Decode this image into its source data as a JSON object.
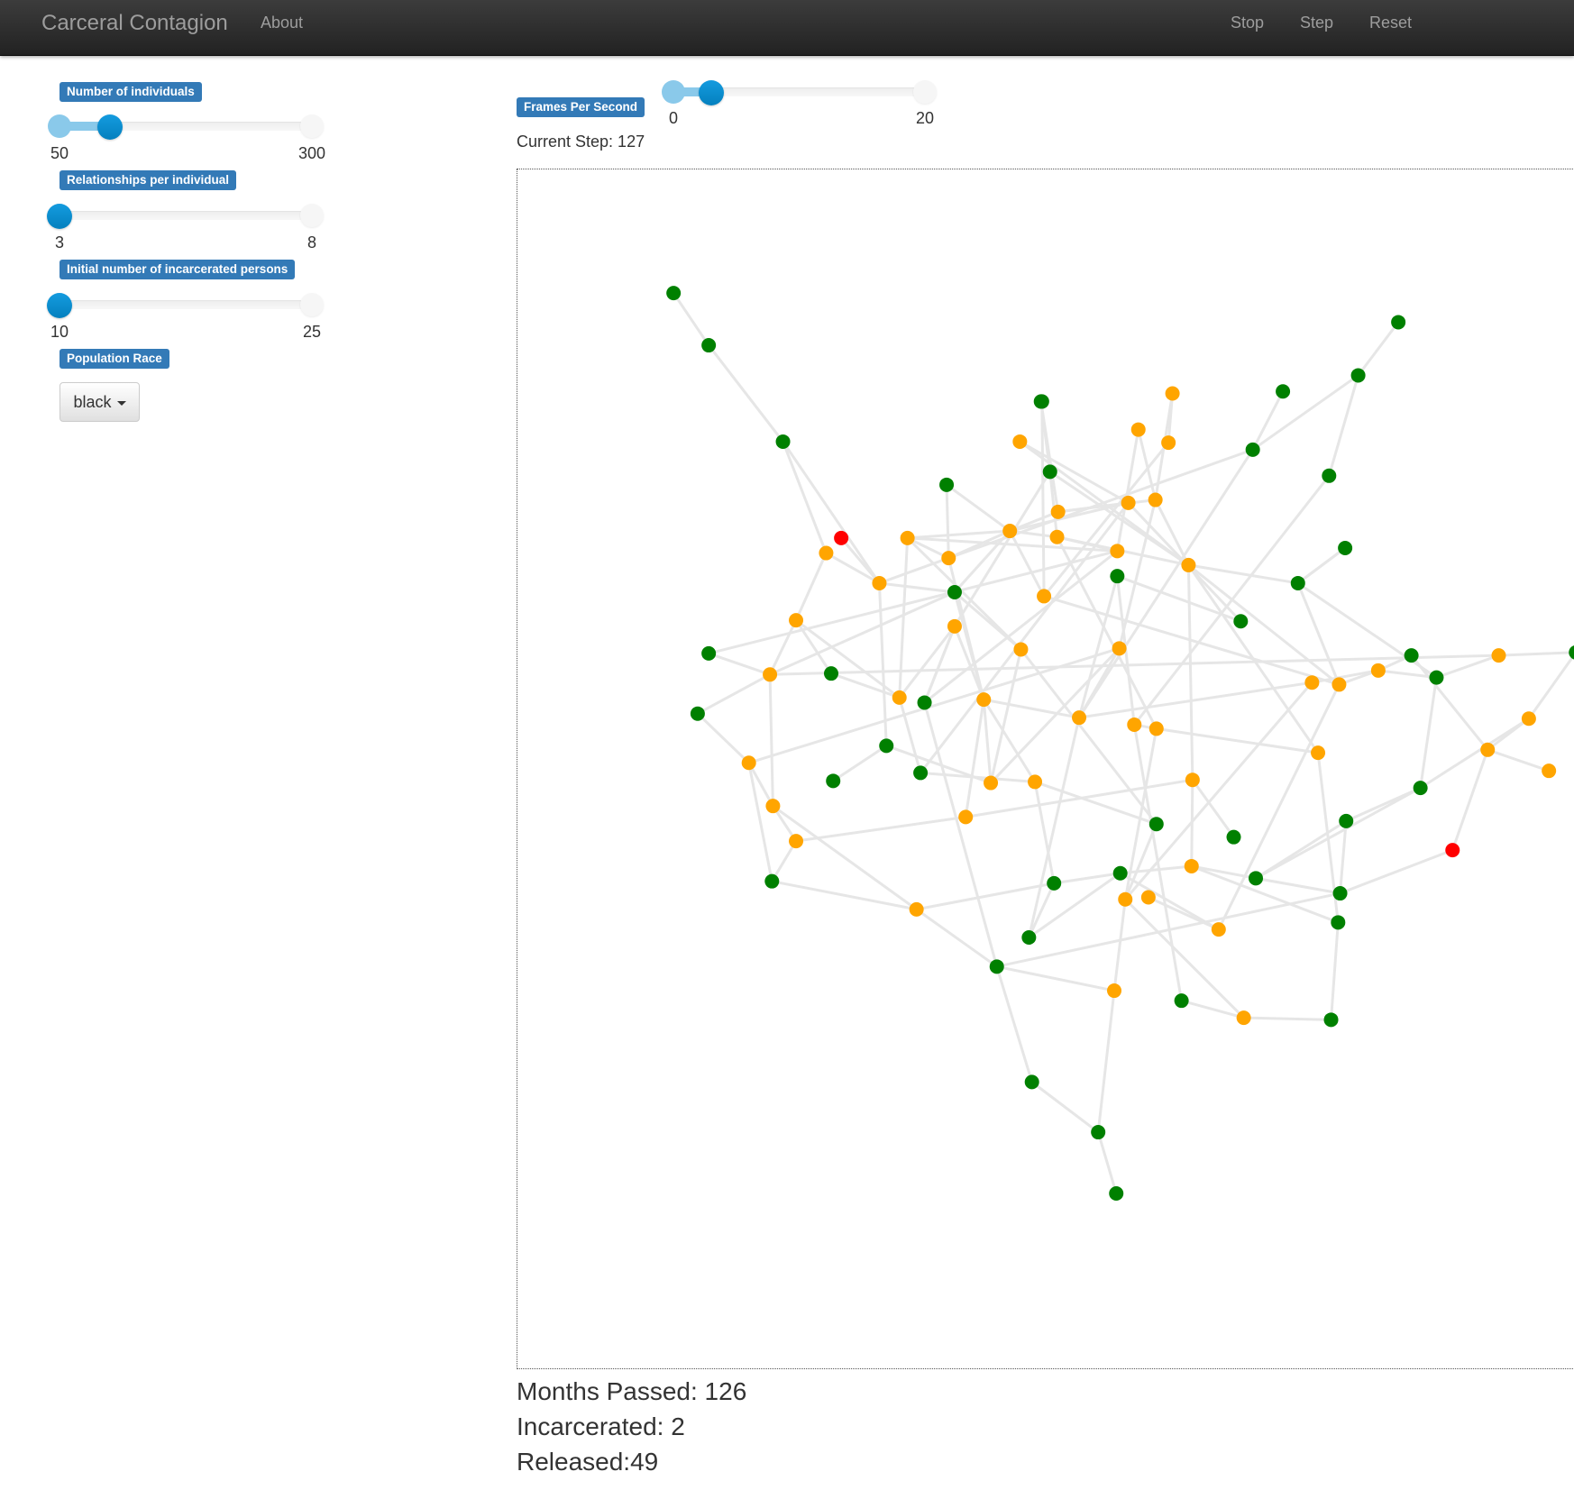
{
  "navbar": {
    "brand": "Carceral Contagion",
    "links": {
      "about": "About",
      "stop": "Stop",
      "step": "Step",
      "reset": "Reset"
    }
  },
  "sidebar": {
    "sliders": [
      {
        "label": "Number of individuals",
        "min": 50,
        "max": 300,
        "value": 100,
        "min_label": "50",
        "max_label": "300"
      },
      {
        "label": "Relationships per individual",
        "min": 3,
        "max": 8,
        "value": 3,
        "min_label": "3",
        "max_label": "8"
      },
      {
        "label": "Initial number of incarcerated persons",
        "min": 10,
        "max": 25,
        "value": 10,
        "min_label": "10",
        "max_label": "25"
      }
    ],
    "race": {
      "label": "Population Race",
      "selected": "black"
    }
  },
  "main": {
    "fps": {
      "label": "Frames Per Second",
      "min": 0,
      "max": 20,
      "value": 3,
      "min_label": "0",
      "max_label": "20"
    },
    "current_step": "Current Step: 127",
    "stats": {
      "months": "Months Passed: 126",
      "incarcerated": "Incarcerated: 2",
      "released": "Released:49"
    }
  },
  "colors": {
    "accent": "#337ab7",
    "slider_handle": "#0e8fd6",
    "edge": "#e6e6e6",
    "status": {
      "free": "#008000",
      "released": "#ffa500",
      "incarcerated": "#ff0000"
    }
  },
  "network": {
    "node_status": [
      "free",
      "free",
      "free",
      "incarcerated",
      "released",
      "released",
      "released",
      "released",
      "released",
      "free",
      "released",
      "free",
      "released",
      "released",
      "free",
      "free",
      "free",
      "released",
      "released",
      "released",
      "free",
      "released",
      "released",
      "released",
      "free",
      "free",
      "free",
      "released",
      "released",
      "released",
      "released",
      "free",
      "released",
      "released",
      "released",
      "released",
      "free",
      "free",
      "released",
      "released",
      "released",
      "released",
      "released",
      "free",
      "free",
      "free",
      "released",
      "released",
      "released",
      "free",
      "free",
      "released",
      "released",
      "free",
      "released",
      "free",
      "free",
      "released",
      "released",
      "released",
      "free",
      "free",
      "released",
      "released",
      "free",
      "free",
      "free",
      "free",
      "released",
      "free",
      "released",
      "released",
      "released",
      "free",
      "released",
      "free",
      "incarcerated",
      "released",
      "released",
      "free",
      "free",
      "free",
      "released",
      "free",
      "free",
      "released",
      "free",
      "free",
      "released",
      "free"
    ]
  }
}
